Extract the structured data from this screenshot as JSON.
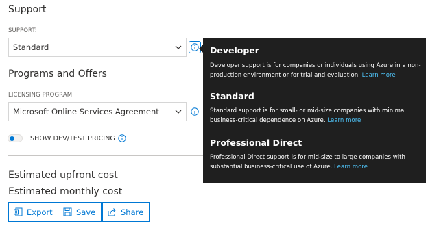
{
  "support": {
    "heading": "Support",
    "label": "SUPPORT:",
    "selected": "Standard"
  },
  "programs": {
    "heading": "Programs and Offers",
    "label": "LICENSING PROGRAM:",
    "selected": "Microsoft Online Services Agreement",
    "devtest_label": "SHOW DEV/TEST PRICING"
  },
  "estimates": {
    "upfront": "Estimated upfront cost",
    "monthly": "Estimated monthly cost"
  },
  "actions": {
    "export": "Export",
    "save": "Save",
    "share": "Share"
  },
  "tooltip": {
    "sections": [
      {
        "title": "Developer",
        "body": "Developer support is for companies or individuals using Azure in a non-production environment or for trial and evaluation.",
        "link": "Learn more"
      },
      {
        "title": "Standard",
        "body": "Standard support is for small- or mid-size companies with minimal business-critical dependence on Azure.",
        "link": "Learn more"
      },
      {
        "title": "Professional Direct",
        "body": "Professional Direct support is for mid-size to large companies with substantial business-critical use of Azure.",
        "link": "Learn more"
      }
    ]
  },
  "colors": {
    "accent": "#0078d4",
    "tooltip_bg": "#1f1f1f",
    "tooltip_link": "#4fc3f7"
  }
}
